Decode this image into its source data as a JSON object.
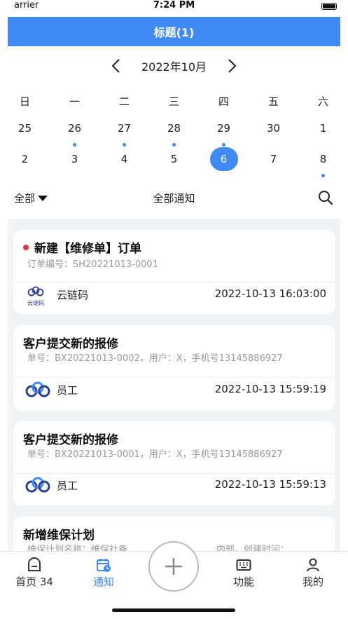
{
  "status_bar": {
    "carrier": "arrier",
    "time": "7:24 PM"
  },
  "header": {
    "title": "标题(1)"
  },
  "calendar": {
    "month_label": "2022年10月",
    "weekdays": [
      "日",
      "一",
      "二",
      "三",
      "四",
      "五",
      "六"
    ],
    "week1": [
      "25",
      "26",
      "27",
      "28",
      "29",
      "30",
      "1"
    ],
    "week2": [
      "2",
      "3",
      "4",
      "5",
      "6",
      "7",
      "8"
    ],
    "selected_date": "6",
    "dots_week1": [
      false,
      true,
      true,
      true,
      true,
      false,
      false
    ],
    "dots_week2": [
      false,
      false,
      false,
      false,
      false,
      false,
      true
    ]
  },
  "filter": {
    "all_label": "全部",
    "title": "全部通知"
  },
  "notifications": [
    {
      "title": "新建【维修单】订单",
      "subtitle": "订单编号：SH20221013-0001",
      "sender": "云链码",
      "logo_text": "云链码",
      "time": "2022-10-13 16:03:00",
      "unread": true
    },
    {
      "title": "客户提交新的报修",
      "subtitle": "单号：BX20221013-0002，用户：X，手机号13145886927",
      "sender": "员工",
      "time": "2022-10-13 15:59:19",
      "unread": false
    },
    {
      "title": "客户提交新的报修",
      "subtitle": "单号：BX20221013-0001，用户：X，手机号13145886927",
      "sender": "员工",
      "time": "2022-10-13 15:59:13",
      "unread": false
    },
    {
      "title": "新增维保计划",
      "subtitle": "维保计划名称：维保社备",
      "subtitle_right": "内部，创建时间：",
      "unread": false
    }
  ],
  "tab_bar": {
    "home_label": "首页 34",
    "notify_label": "通知",
    "features_label": "功能",
    "mine_label": "我的"
  },
  "colors": {
    "accent": "#3f8af5",
    "unread": "#d9363e",
    "list_bg": "#f2f3f5"
  }
}
